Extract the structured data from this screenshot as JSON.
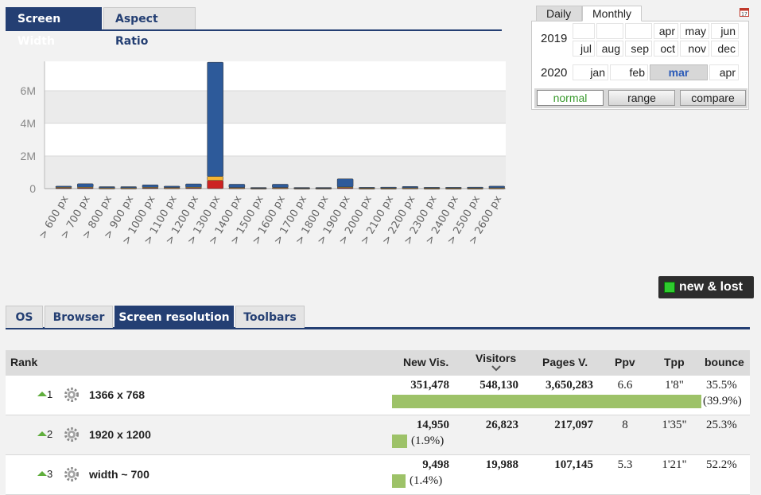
{
  "top_tabs": [
    "Screen Width",
    "Aspect Ratio"
  ],
  "period": {
    "tabs": [
      "Daily",
      "Monthly"
    ],
    "active_tab": "Monthly",
    "years": [
      "2019",
      "2020"
    ],
    "rows_2019": [
      [
        "",
        "",
        "",
        "apr",
        "may",
        "jun"
      ],
      [
        "jul",
        "aug",
        "sep",
        "oct",
        "nov",
        "dec"
      ]
    ],
    "row_2020": [
      "jan",
      "feb",
      "mar",
      "apr"
    ],
    "selected": "mar",
    "modes": [
      "normal",
      "range",
      "compare"
    ],
    "active_mode": "normal"
  },
  "chart_data": {
    "type": "bar",
    "stacked": true,
    "categories": [
      "> 600 px",
      "> 700 px",
      "> 800 px",
      "> 900 px",
      "> 1000 px",
      "> 1100 px",
      "> 1200 px",
      "> 1300 px",
      "> 1400 px",
      "> 1500 px",
      "> 1600 px",
      "> 1700 px",
      "> 1800 px",
      "> 1900 px",
      "> 2000 px",
      "> 2100 px",
      "> 2200 px",
      "> 2300 px",
      "> 2400 px",
      "> 2500 px",
      "> 2600 px"
    ],
    "series": [
      {
        "color": "#cc2222",
        "values": [
          0.05,
          0.05,
          0.03,
          0.03,
          0.05,
          0.04,
          0.05,
          0.5,
          0.04,
          0.02,
          0.04,
          0.02,
          0.02,
          0.05,
          0.02,
          0.02,
          0.03,
          0.02,
          0.02,
          0.02,
          0.03
        ]
      },
      {
        "color": "#f5b533",
        "values": [
          0.03,
          0.04,
          0.02,
          0.02,
          0.03,
          0.03,
          0.04,
          0.25,
          0.03,
          0.01,
          0.03,
          0.01,
          0.01,
          0.05,
          0.01,
          0.01,
          0.02,
          0.01,
          0.01,
          0.01,
          0.02
        ]
      },
      {
        "color": "#2d5a9a",
        "values": [
          0.07,
          0.21,
          0.07,
          0.07,
          0.15,
          0.08,
          0.2,
          7.0,
          0.2,
          0.04,
          0.2,
          0.04,
          0.04,
          0.5,
          0.05,
          0.06,
          0.08,
          0.05,
          0.05,
          0.06,
          0.1
        ]
      }
    ],
    "yticks": [
      "0",
      "2M",
      "4M",
      "6M"
    ],
    "ylim": [
      0,
      7.8
    ]
  },
  "new_lost_label": "new & lost",
  "sub_tabs": [
    "OS",
    "Browser",
    "Screen resolution",
    "Toolbars"
  ],
  "active_sub_tab": "Screen resolution",
  "table": {
    "headers": {
      "rank": "Rank",
      "new_vis": "New Vis.",
      "visitors": "Visitors",
      "pages": "Pages V.",
      "ppv": "Ppv",
      "tpp": "Tpp",
      "bounce": "bounce"
    },
    "rows": [
      {
        "rank": "1",
        "name": "1366 x 768",
        "new_vis": "351,478",
        "visitors": "548,130",
        "pages": "3,650,283",
        "ppv": "6.6",
        "tpp": "1'8\"",
        "bounce": "35.5%",
        "share": 39.9,
        "share_label": "(39.9%)"
      },
      {
        "rank": "2",
        "name": "1920 x 1200",
        "new_vis": "14,950",
        "visitors": "26,823",
        "pages": "217,097",
        "ppv": "8",
        "tpp": "1'35\"",
        "bounce": "25.3%",
        "share": 1.9,
        "share_label": "(1.9%)"
      },
      {
        "rank": "3",
        "name": "width ~ 700",
        "new_vis": "9,498",
        "visitors": "19,988",
        "pages": "107,145",
        "ppv": "5.3",
        "tpp": "1'21\"",
        "bounce": "52.2%",
        "share": 1.4,
        "share_label": "(1.4%)"
      }
    ]
  },
  "colors": {
    "accent": "#243f73",
    "up": "#5fae3c",
    "bar": "#9dc268"
  }
}
